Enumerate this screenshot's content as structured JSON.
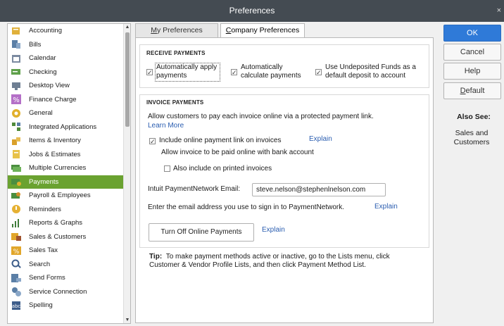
{
  "window": {
    "title": "Preferences",
    "close_glyph": "×"
  },
  "sidebar": {
    "selected": "Payments",
    "items": [
      {
        "label": "Accounting",
        "icon": "accounting-icon"
      },
      {
        "label": "Bills",
        "icon": "bills-icon"
      },
      {
        "label": "Calendar",
        "icon": "calendar-icon"
      },
      {
        "label": "Checking",
        "icon": "checking-icon"
      },
      {
        "label": "Desktop View",
        "icon": "desktop-view-icon"
      },
      {
        "label": "Finance Charge",
        "icon": "finance-charge-icon"
      },
      {
        "label": "General",
        "icon": "general-icon"
      },
      {
        "label": "Integrated Applications",
        "icon": "integrated-applications-icon"
      },
      {
        "label": "Items & Inventory",
        "icon": "items-inventory-icon"
      },
      {
        "label": "Jobs & Estimates",
        "icon": "jobs-estimates-icon"
      },
      {
        "label": "Multiple Currencies",
        "icon": "multiple-currencies-icon"
      },
      {
        "label": "Payments",
        "icon": "payments-icon"
      },
      {
        "label": "Payroll & Employees",
        "icon": "payroll-employees-icon"
      },
      {
        "label": "Reminders",
        "icon": "reminders-icon"
      },
      {
        "label": "Reports & Graphs",
        "icon": "reports-graphs-icon"
      },
      {
        "label": "Sales & Customers",
        "icon": "sales-customers-icon"
      },
      {
        "label": "Sales Tax",
        "icon": "sales-tax-icon"
      },
      {
        "label": "Search",
        "icon": "search-icon"
      },
      {
        "label": "Send Forms",
        "icon": "send-forms-icon"
      },
      {
        "label": "Service Connection",
        "icon": "service-connection-icon"
      },
      {
        "label": "Spelling",
        "icon": "spelling-icon"
      }
    ]
  },
  "tabs": [
    {
      "label": "My Preferences",
      "mnemonic": "M",
      "rest": "y Preferences",
      "active": false
    },
    {
      "label": "Company Preferences",
      "mnemonic": "C",
      "rest": "ompany Preferences",
      "active": true
    }
  ],
  "receive_payments": {
    "title": "RECEIVE PAYMENTS",
    "auto_apply": {
      "line1": "Automatically apply",
      "line2": "payments",
      "checked": true
    },
    "auto_calc": {
      "line1": "Automatically",
      "line2": "calculate payments",
      "checked": true
    },
    "undeposited": {
      "line1": "Use Undeposited Funds as a",
      "line2": "default deposit to account",
      "checked": true
    }
  },
  "invoice_payments": {
    "title": "INVOICE PAYMENTS",
    "intro": "Allow customers to pay each invoice online via a protected payment link.",
    "learn_more": "Learn More",
    "include_link": {
      "label": "Include online payment link on invoices",
      "checked": true
    },
    "explain1": "Explain",
    "bank_account_text": "Allow invoice to be paid online with bank account",
    "also_printed": {
      "label": "Also include on printed invoices",
      "checked": false
    },
    "email_label": "Intuit PaymentNetwork Email:",
    "email_value": "steve.nelson@stephenlnelson.com",
    "email_hint": "Enter the email address you use to sign in to PaymentNetwork.",
    "explain2": "Explain",
    "turn_off_button": "Turn Off Online Payments",
    "explain3": "Explain"
  },
  "tip": {
    "label": "Tip:",
    "line1": "To make payment methods active or inactive, go to the Lists menu, click",
    "line2": "Customer & Vendor Profile Lists, and then click Payment Method List."
  },
  "buttons": {
    "ok": "OK",
    "cancel": "Cancel",
    "help": "Help",
    "default_mnemonic": "D",
    "default_rest": "efault"
  },
  "also_see": {
    "title": "Also See:",
    "line1": "Sales and",
    "line2": "Customers"
  },
  "colors": {
    "title_bar": "#444b52",
    "selected_item": "#6aa230",
    "ok_button": "#2f7ad8",
    "link": "#2a5db0"
  }
}
